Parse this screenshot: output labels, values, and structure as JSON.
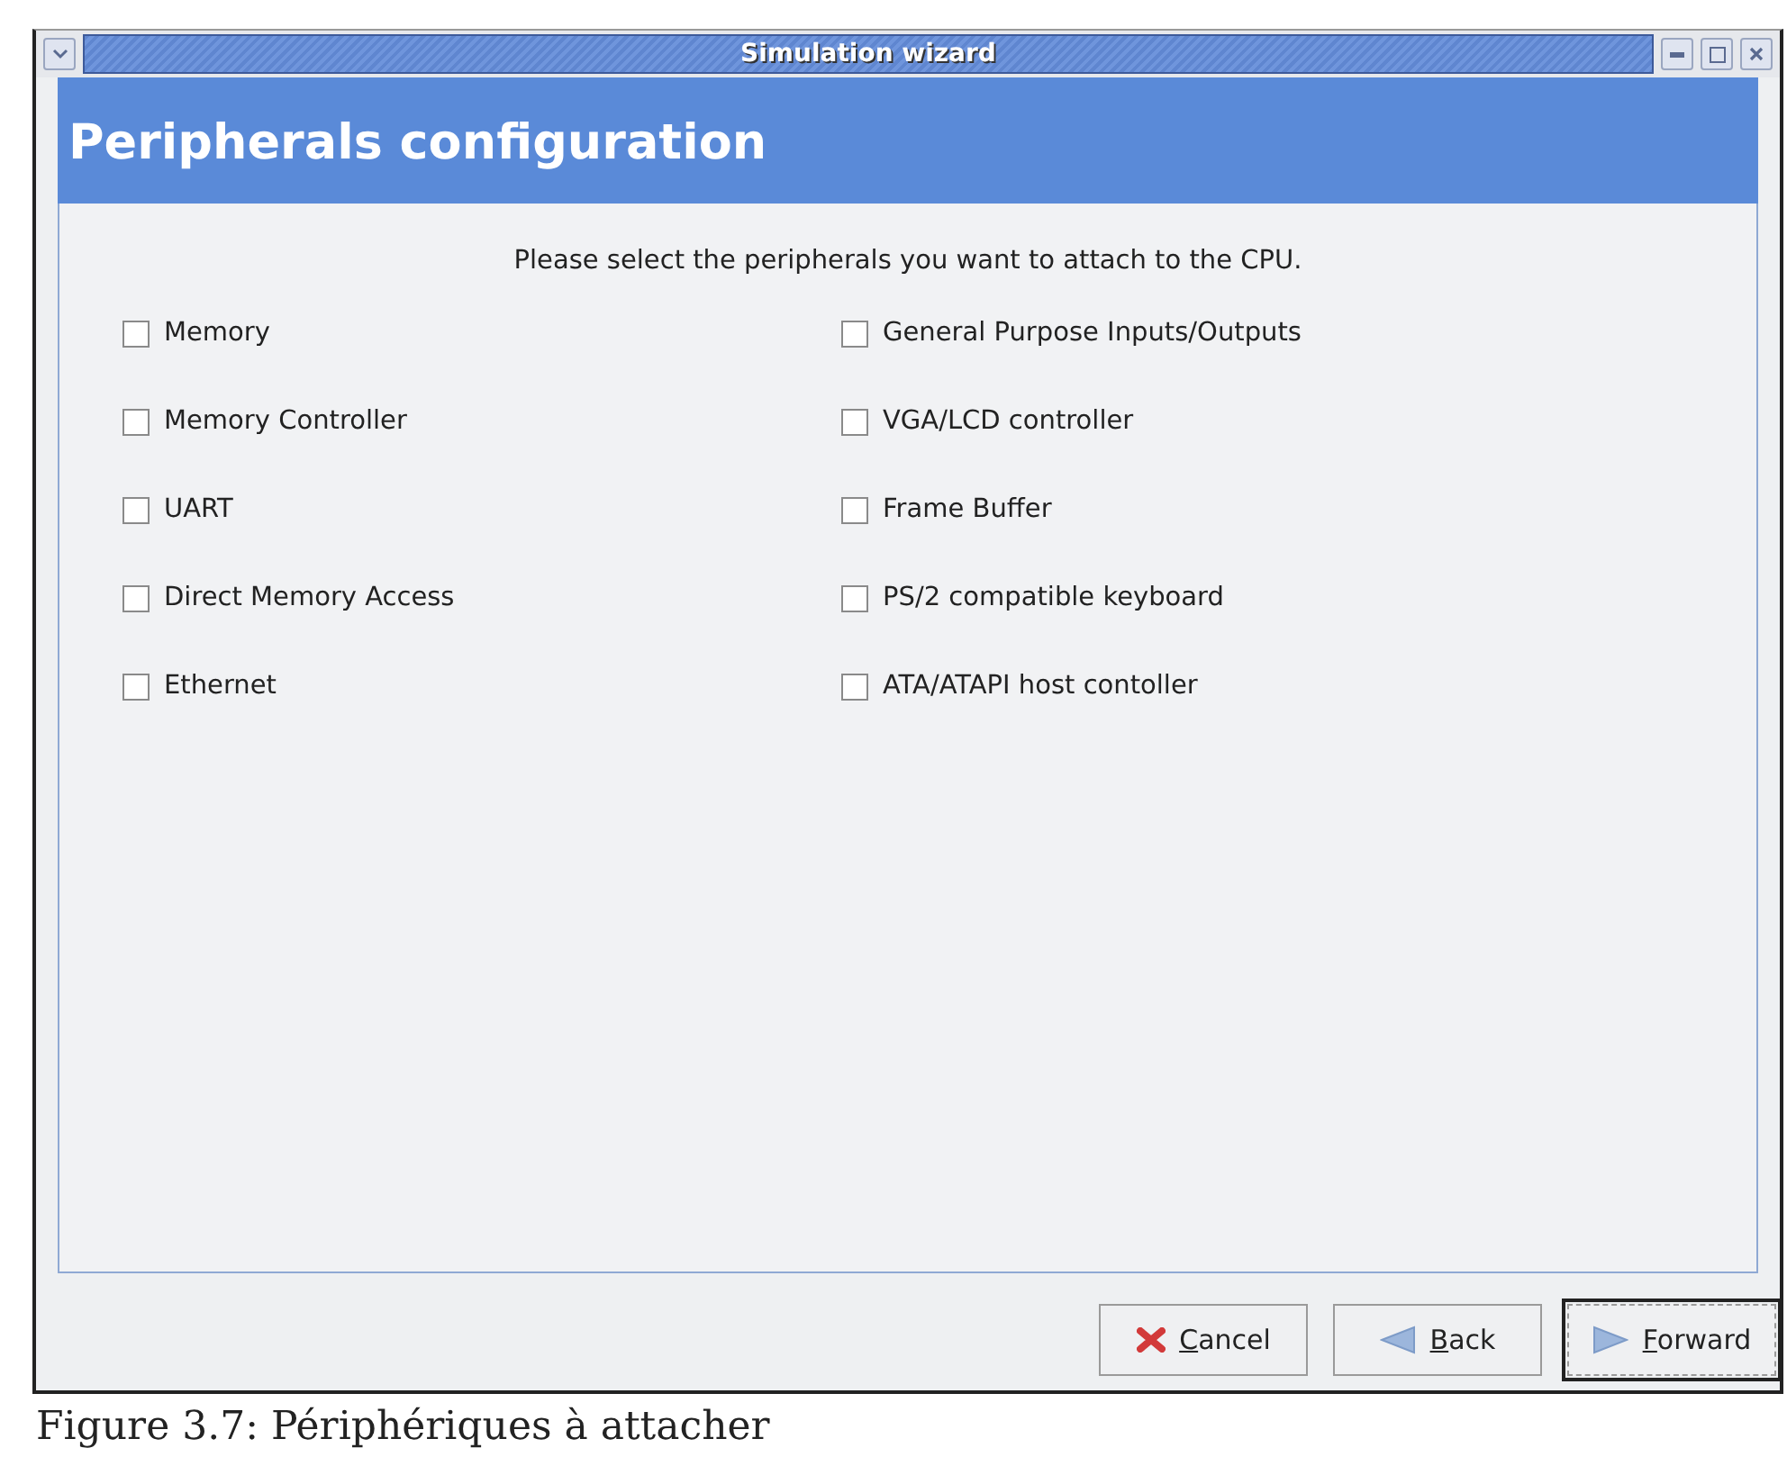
{
  "window": {
    "title": "Simulation wizard"
  },
  "header": {
    "title": "Peripherals configuration"
  },
  "instruction": "Please select the peripherals you want to attach to the CPU.",
  "peripherals": [
    {
      "label": "Memory",
      "checked": false
    },
    {
      "label": "General Purpose Inputs/Outputs",
      "checked": false
    },
    {
      "label": "Memory Controller",
      "checked": false
    },
    {
      "label": "VGA/LCD controller",
      "checked": false
    },
    {
      "label": "UART",
      "checked": false
    },
    {
      "label": "Frame Buffer",
      "checked": false
    },
    {
      "label": "Direct Memory Access",
      "checked": false
    },
    {
      "label": "PS/2 compatible keyboard",
      "checked": false
    },
    {
      "label": "Ethernet",
      "checked": false
    },
    {
      "label": "ATA/ATAPI host contoller",
      "checked": false
    }
  ],
  "buttons": [
    {
      "kind": "cancel",
      "label": "Cancel",
      "default": false
    },
    {
      "kind": "back",
      "label": "Back",
      "default": false
    },
    {
      "kind": "forward",
      "label": "Forward",
      "default": true
    }
  ],
  "caption": "Figure 3.7: Périphériques à attacher"
}
